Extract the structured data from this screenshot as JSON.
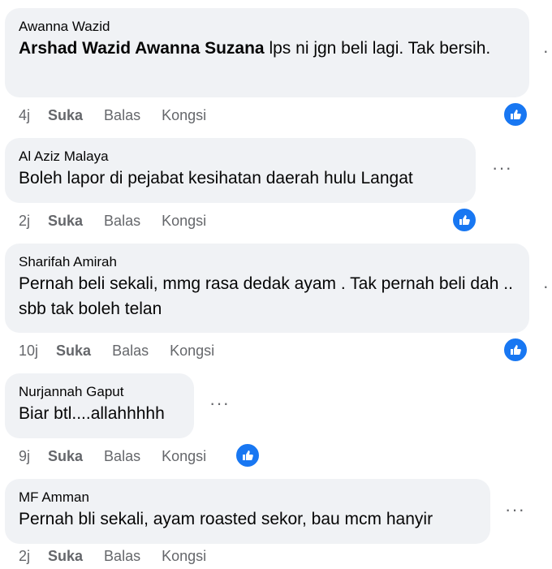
{
  "comments": [
    {
      "author": "Awanna Wazid",
      "mention": "Arshad Wazid Awanna Suzana",
      "text": " lps ni jgn beli lagi. Tak bersih.",
      "time": "4j"
    },
    {
      "author": "Al Aziz Malaya",
      "text": "Boleh lapor di pejabat kesihatan daerah hulu Langat",
      "time": "2j"
    },
    {
      "author": "Sharifah Amirah",
      "text": "Pernah beli sekali, mmg rasa dedak ayam . Tak pernah beli dah .. sbb tak boleh telan",
      "time": "10j"
    },
    {
      "author": "Nurjannah Gaput",
      "text": "Biar btl....allahhhhh",
      "time": "9j"
    },
    {
      "author": "MF Amman",
      "text": "Pernah bli sekali, ayam roasted sekor, bau mcm hanyir",
      "time": "2j"
    }
  ],
  "actions": {
    "like": "Suka",
    "reply": "Balas",
    "share": "Kongsi"
  },
  "icons": {
    "reaction": "like-thumb-icon",
    "more": "more-options-icon"
  },
  "colors": {
    "bubble": "#f0f2f5",
    "reaction": "#1877f2",
    "meta": "#65676b"
  }
}
